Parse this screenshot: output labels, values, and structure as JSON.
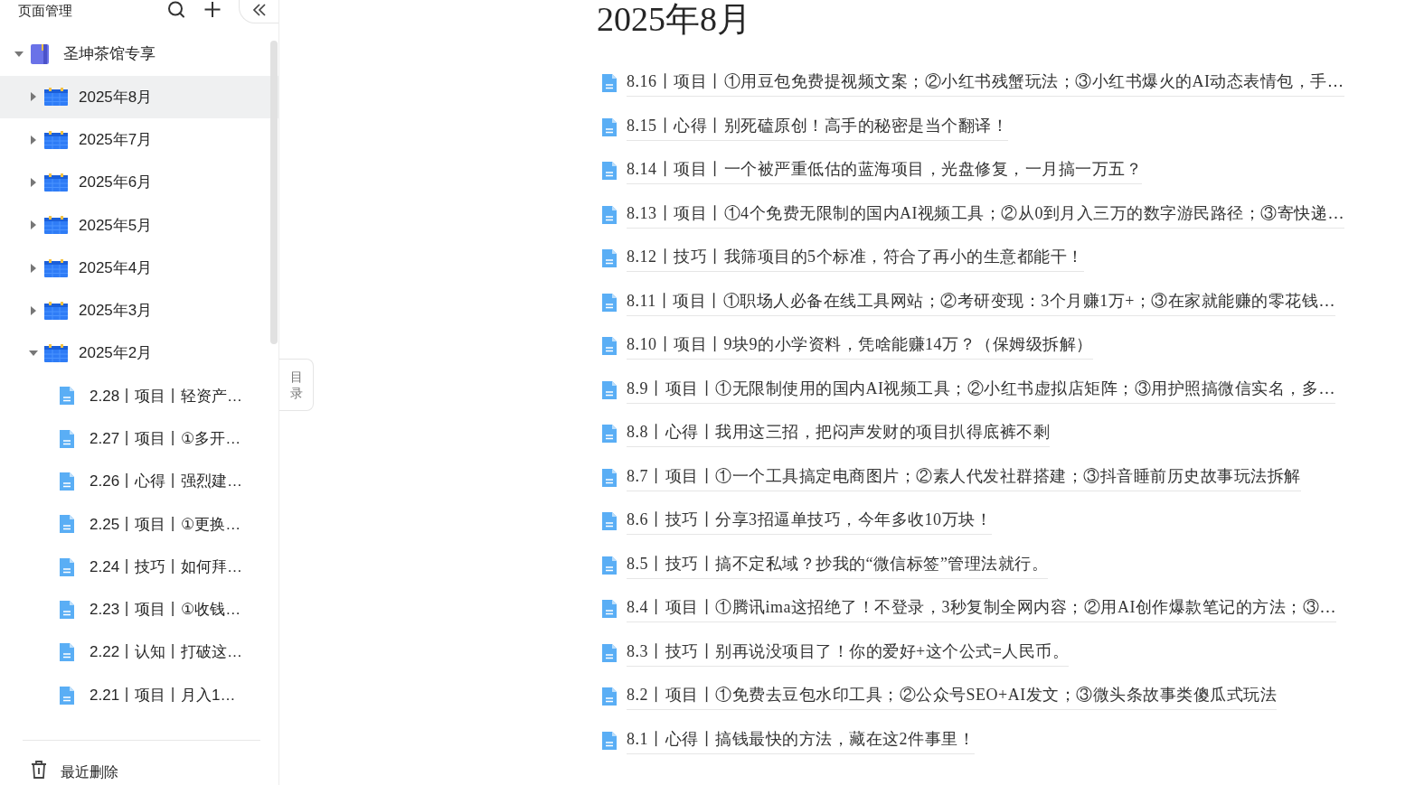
{
  "sidebar": {
    "title": "页面管理",
    "tree": {
      "label": "圣坤茶馆专享",
      "expanded": true,
      "children": [
        {
          "label": "2025年8月",
          "kind": "month",
          "expanded": false,
          "selected": true
        },
        {
          "label": "2025年7月",
          "kind": "month",
          "expanded": false,
          "selected": false
        },
        {
          "label": "2025年6月",
          "kind": "month",
          "expanded": false,
          "selected": false
        },
        {
          "label": "2025年5月",
          "kind": "month",
          "expanded": false,
          "selected": false
        },
        {
          "label": "2025年4月",
          "kind": "month",
          "expanded": false,
          "selected": false
        },
        {
          "label": "2025年3月",
          "kind": "month",
          "expanded": false,
          "selected": false
        },
        {
          "label": "2025年2月",
          "kind": "month",
          "expanded": true,
          "selected": false,
          "children": [
            {
              "label": "2.28丨项目丨轻资产…",
              "kind": "doc",
              "selected": false
            },
            {
              "label": "2.27丨项目丨①多开…",
              "kind": "doc",
              "selected": false
            },
            {
              "label": "2.26丨心得丨强烈建…",
              "kind": "doc",
              "selected": false
            },
            {
              "label": "2.25丨项目丨①更换…",
              "kind": "doc",
              "selected": false
            },
            {
              "label": "2.24丨技巧丨如何拜…",
              "kind": "doc",
              "selected": false
            },
            {
              "label": "2.23丨项目丨①收钱…",
              "kind": "doc",
              "selected": false
            },
            {
              "label": "2.22丨认知丨打破这…",
              "kind": "doc",
              "selected": false
            },
            {
              "label": "2.21丨项目丨月入1…",
              "kind": "doc",
              "selected": false
            }
          ]
        }
      ]
    },
    "trash": "最近删除"
  },
  "toc_tab": "目录",
  "page": {
    "title": "2025年8月",
    "links": [
      "8.16丨项目丨①用豆包免费提视频文案；②小红书残蟹玩法；③小红书爆火的AI动态表情包，手…",
      "8.15丨心得丨别死磕原创！高手的秘密是当个翻译！",
      "8.14丨项目丨一个被严重低估的蓝海项目，光盘修复，一月搞一万五？",
      "8.13丨项目丨①4个免费无限制的国内AI视频工具；②从0到月入三万的数字游民路径；③寄快递…",
      "8.12丨技巧丨我筛项目的5个标准，符合了再小的生意都能干！",
      "8.11丨项目丨①职场人必备在线工具网站；②考研变现：3个月赚1万+；③在家就能赚的零花钱…",
      "8.10丨项目丨9块9的小学资料，凭啥能赚14万？（保姆级拆解）",
      "8.9丨项目丨①无限制使用的国内AI视频工具；②小红书虚拟店矩阵；③用护照搞微信实名，多…",
      "8.8丨心得丨我用这三招，把闷声发财的项目扒得底裤不剩",
      "8.7丨项目丨①一个工具搞定电商图片；②素人代发社群搭建；③抖音睡前历史故事玩法拆解",
      "8.6丨技巧丨分享3招逼单技巧，今年多收10万块！",
      "8.5丨技巧丨搞不定私域？抄我的“微信标签”管理法就行。",
      "8.4丨项目丨①腾讯ima这招绝了！不登录，3秒复制全网内容；②用AI创作爆款笔记的方法；③…",
      "8.3丨技巧丨别再说没项目了！你的爱好+这个公式=人民币。",
      "8.2丨项目丨①免费去豆包水印工具；②公众号SEO+AI发文；③微头条故事类傻瓜式玩法",
      "8.1丨心得丨搞钱最快的方法，藏在这2件事里！"
    ]
  }
}
